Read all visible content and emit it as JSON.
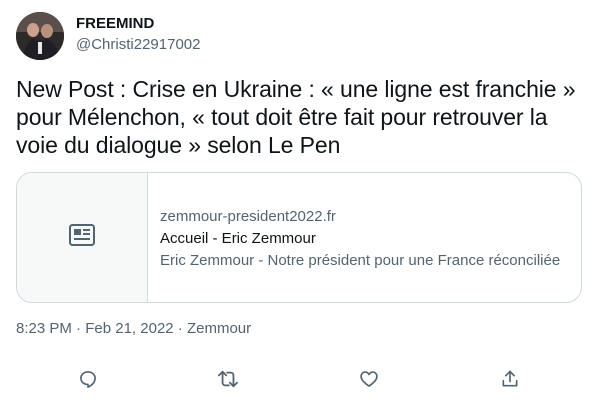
{
  "author": {
    "display_name": "FREEMIND",
    "handle": "@Christi22917002"
  },
  "tweet": {
    "text": "New Post : Crise en Ukraine : « une ligne est franchie » pour Mélenchon, « tout doit être fait pour retrouver la voie du dialogue » selon Le Pen"
  },
  "card": {
    "thumb_icon": "news-article-icon",
    "domain": "zemmour-president2022.fr",
    "title": "Accueil - Eric Zemmour",
    "description": "Eric Zemmour - Notre président pour une France réconciliée"
  },
  "meta": {
    "time": "8:23 PM",
    "separator": " · ",
    "date": "Feb 21, 2022",
    "source": "Zemmour"
  },
  "actions": {
    "icons": [
      "reply-icon",
      "retweet-icon",
      "like-icon",
      "share-icon"
    ]
  },
  "colors": {
    "text_primary": "#0f1419",
    "text_secondary": "#536471",
    "border": "#cfd9de",
    "card_thumb_bg": "#f7f9f9"
  }
}
